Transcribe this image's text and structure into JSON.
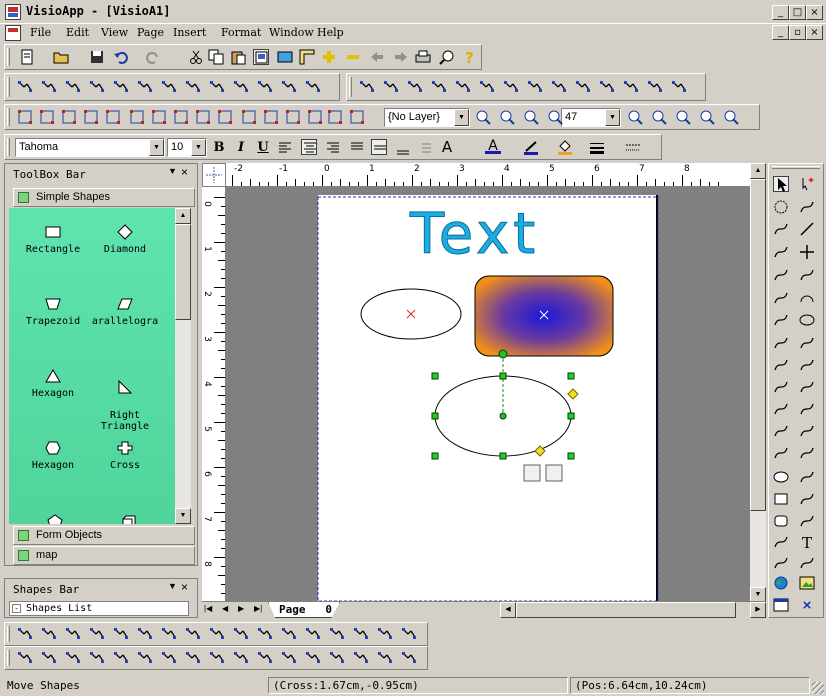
{
  "window": {
    "title": "VisioApp - [VisioA1]",
    "minimize": "_",
    "maximize": "□",
    "close": "×"
  },
  "menu": [
    "File",
    "Edit",
    "View",
    "Page",
    "Insert",
    "Format",
    "Window",
    "Help"
  ],
  "format_toolbar": {
    "font": "Tahoma",
    "size": "10",
    "layer": "{No Layer}",
    "zoom": "47"
  },
  "toolbox": {
    "title": "ToolBox Bar",
    "categories": [
      "Simple Shapes",
      "Form Objects",
      "map"
    ],
    "shapes": [
      {
        "label": "Rectangle",
        "icon": "rectangle-icon"
      },
      {
        "label": "Diamond",
        "icon": "diamond-icon"
      },
      {
        "label": "Trapezoid",
        "icon": "trapezoid-icon"
      },
      {
        "label": "arallelogra",
        "icon": "parallelogram-icon"
      },
      {
        "label": "Hexagon",
        "icon": "triangle-icon"
      },
      {
        "label": "Right\nTriangle",
        "icon": "right-triangle-icon"
      },
      {
        "label": "Hexagon",
        "icon": "hexagon-icon"
      },
      {
        "label": "Cross",
        "icon": "cross-icon"
      }
    ]
  },
  "shapes_bar": {
    "title": "Shapes Bar",
    "list_label": "Shapes List"
  },
  "ruler": {
    "h_ticks": [
      "-2",
      "-1",
      "0",
      "1",
      "2",
      "3",
      "4",
      "5",
      "6",
      "7",
      "8"
    ],
    "v_ticks": [
      "0",
      "1",
      "2",
      "3",
      "4",
      "5",
      "6",
      "7",
      "8"
    ]
  },
  "canvas": {
    "text_shape": "Text",
    "page_tab": "Page   0"
  },
  "status": {
    "mode": "Move Shapes",
    "cross": "(Cross:1.67cm,-0.95cm)",
    "pos": "(Pos:6.64cm,10.24cm)"
  },
  "colors": {
    "toolbox_bg": "#5fd8a0",
    "text_shape": "#1aaee0",
    "rounded_rect_outer": "#f0901a",
    "rounded_rect_inner": "#1a1ad8",
    "workspace": "#808080"
  }
}
